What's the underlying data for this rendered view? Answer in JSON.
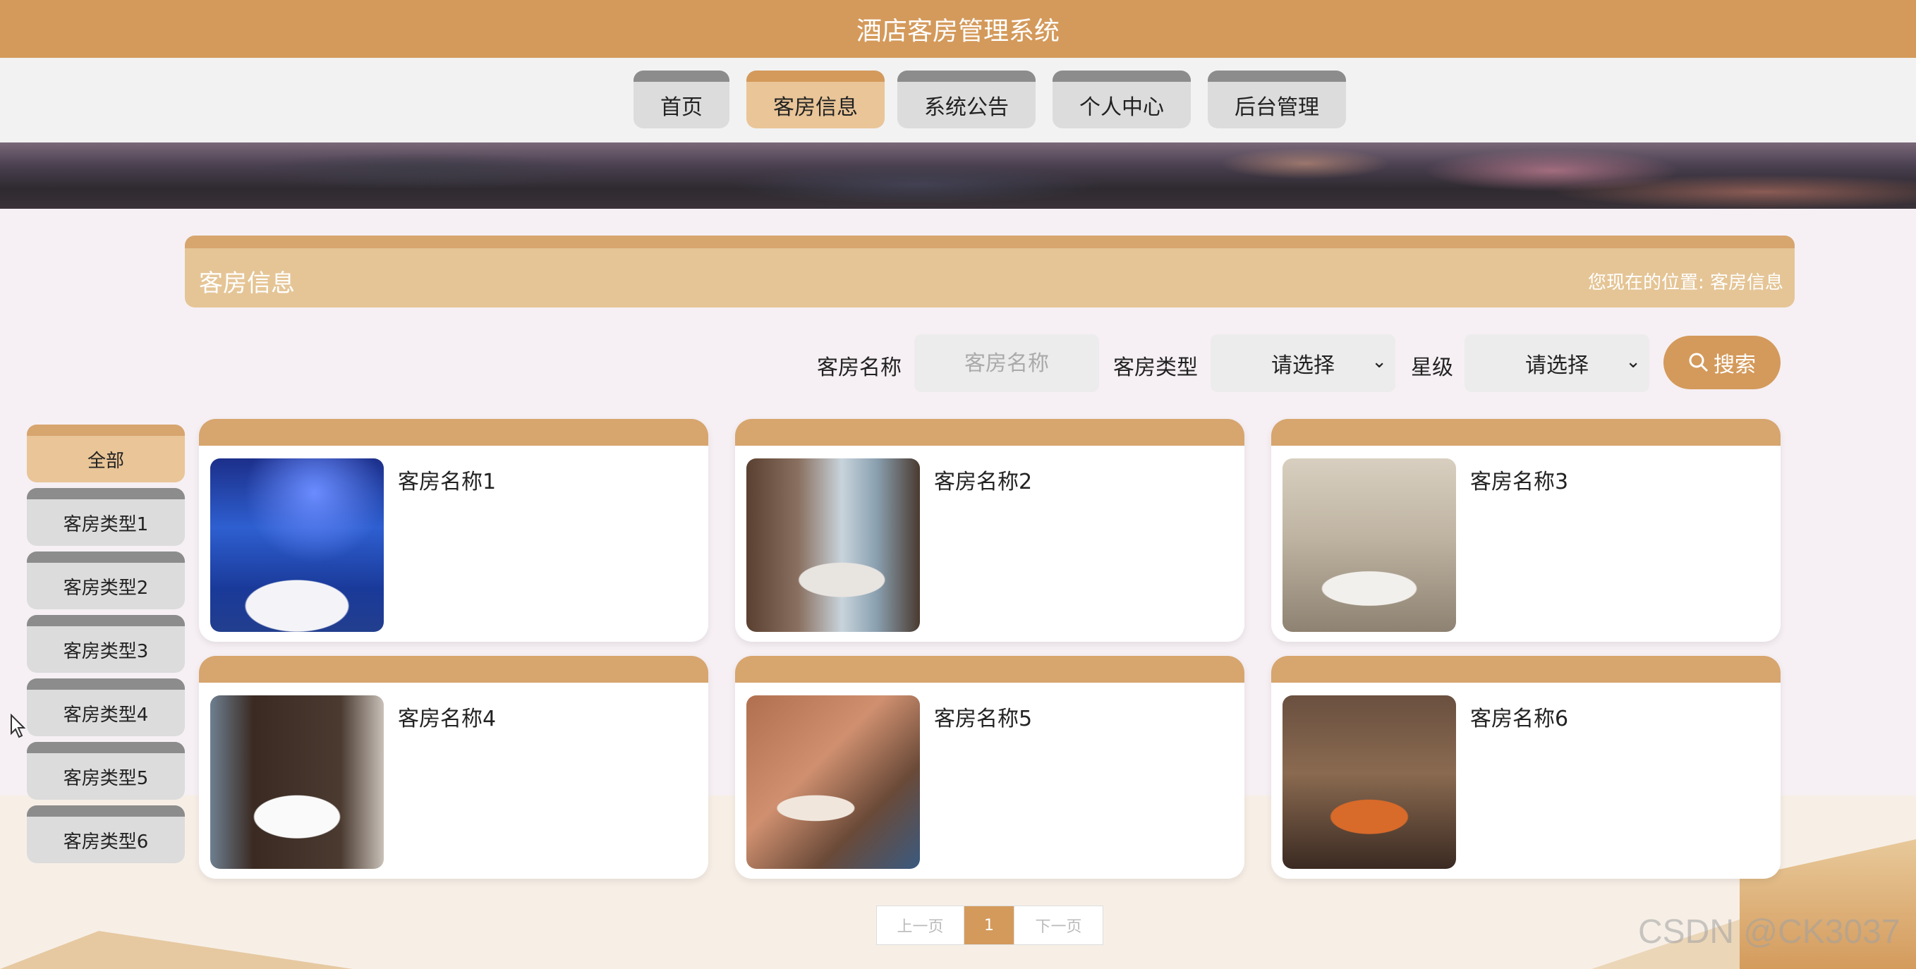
{
  "header": {
    "title": "酒店客房管理系统"
  },
  "nav": {
    "items": [
      {
        "label": "首页"
      },
      {
        "label": "客房信息"
      },
      {
        "label": "系统公告"
      },
      {
        "label": "个人中心"
      },
      {
        "label": "后台管理"
      }
    ],
    "active_index": 1
  },
  "section": {
    "title": "客房信息",
    "location_prefix": "您现在的位置:",
    "location_current": "客房信息"
  },
  "search": {
    "name_label": "客房名称",
    "name_placeholder": "客房名称",
    "type_label": "客房类型",
    "type_value": "请选择",
    "star_label": "星级",
    "star_value": "请选择",
    "button_label": "搜索"
  },
  "sidebar": {
    "items": [
      {
        "label": "全部"
      },
      {
        "label": "客房类型1"
      },
      {
        "label": "客房类型2"
      },
      {
        "label": "客房类型3"
      },
      {
        "label": "客房类型4"
      },
      {
        "label": "客房类型5"
      },
      {
        "label": "客房类型6"
      }
    ],
    "active_index": 0
  },
  "rooms": [
    {
      "name": "客房名称1"
    },
    {
      "name": "客房名称2"
    },
    {
      "name": "客房名称3"
    },
    {
      "name": "客房名称4"
    },
    {
      "name": "客房名称5"
    },
    {
      "name": "客房名称6"
    }
  ],
  "pagination": {
    "prev": "上一页",
    "current": "1",
    "next": "下一页"
  },
  "watermark": "CSDN @CK3037",
  "colors": {
    "primary": "#d49a5b",
    "primary_light": "#e5c596",
    "inactive": "#dcdcdc"
  }
}
